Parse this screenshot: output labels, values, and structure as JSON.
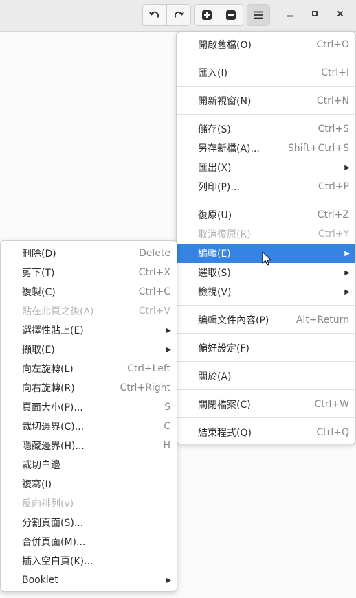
{
  "colors": {
    "accent": "#3584e4",
    "headerbar": "#ebebeb",
    "disabled_text": "#b3b3b3"
  },
  "toolbar": {
    "undo_icon": "rotate-left-icon",
    "redo_icon": "rotate-right-icon",
    "zoom_in_icon": "plus-icon",
    "zoom_out_icon": "minus-icon",
    "menu_icon": "hamburger-icon"
  },
  "window_controls": {
    "minimize_icon": "minimize-icon",
    "maximize_icon": "maximize-icon",
    "close_icon": "close-icon"
  },
  "main_menu": {
    "items": [
      {
        "label": "開啟舊檔(O)",
        "accel": "Ctrl+O"
      },
      {
        "label": "匯入(I)",
        "accel": "Ctrl+I"
      },
      {
        "label": "開新視窗(N)",
        "accel": "Ctrl+N"
      },
      {
        "label": "儲存(S)",
        "accel": "Ctrl+S"
      },
      {
        "label": "另存新檔(A)...",
        "accel": "Shift+Ctrl+S"
      },
      {
        "label": "匯出(X)",
        "accel": ""
      },
      {
        "label": "列印(P)...",
        "accel": "Ctrl+P"
      },
      {
        "label": "復原(U)",
        "accel": "Ctrl+Z"
      },
      {
        "label": "取消復原(R)",
        "accel": "Ctrl+Y"
      },
      {
        "label": "編輯(E)",
        "accel": ""
      },
      {
        "label": "選取(S)",
        "accel": ""
      },
      {
        "label": "檢視(V)",
        "accel": ""
      },
      {
        "label": "編輯文件內容(P)",
        "accel": "Alt+Return"
      },
      {
        "label": "偏好設定(F)",
        "accel": ""
      },
      {
        "label": "關於(A)",
        "accel": ""
      },
      {
        "label": "關閉檔案(C)",
        "accel": "Ctrl+W"
      },
      {
        "label": "結束程式(Q)",
        "accel": "Ctrl+Q"
      }
    ]
  },
  "edit_menu": {
    "items": [
      {
        "label": "刪除(D)",
        "accel": "Delete"
      },
      {
        "label": "剪下(T)",
        "accel": "Ctrl+X"
      },
      {
        "label": "複製(C)",
        "accel": "Ctrl+C"
      },
      {
        "label": "貼在此頁之後(A)",
        "accel": "Ctrl+V"
      },
      {
        "label": "選擇性貼上(E)",
        "accel": ""
      },
      {
        "label": "擷取(E)",
        "accel": ""
      },
      {
        "label": "向左旋轉(L)",
        "accel": "Ctrl+Left"
      },
      {
        "label": "向右旋轉(R)",
        "accel": "Ctrl+Right"
      },
      {
        "label": "頁面大小(P)...",
        "accel": "S"
      },
      {
        "label": "裁切邊界(C)...",
        "accel": "C"
      },
      {
        "label": "隱藏邊界(H)...",
        "accel": "H"
      },
      {
        "label": "裁切白邊",
        "accel": ""
      },
      {
        "label": "複寫(I)",
        "accel": ""
      },
      {
        "label": "反向排列(v)",
        "accel": ""
      },
      {
        "label": "分割頁面(S)...",
        "accel": ""
      },
      {
        "label": "合併頁面(M)...",
        "accel": ""
      },
      {
        "label": "插入空白頁(K)...",
        "accel": ""
      },
      {
        "label": "Booklet",
        "accel": ""
      }
    ]
  }
}
